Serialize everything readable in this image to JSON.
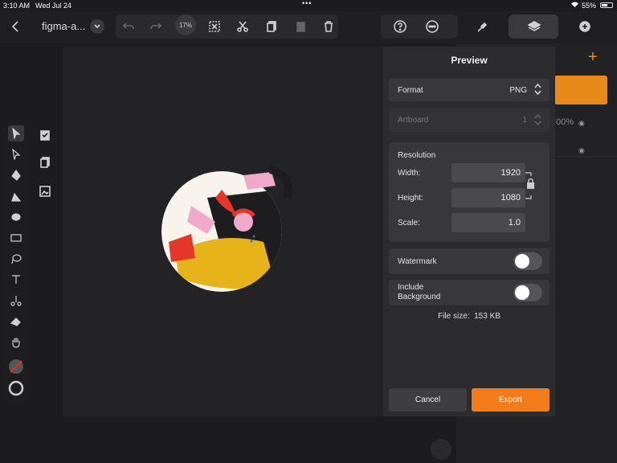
{
  "status_bar": {
    "time": "3:10 AM",
    "date": "Wed Jul 24",
    "battery": "55%",
    "battery_level": 0.55
  },
  "toolbar": {
    "document_title": "figma-a...",
    "zoom": "17%",
    "icons": [
      "back-icon",
      "chevron-down-icon",
      "undo-icon",
      "redo-icon",
      "zoom-indicator",
      "select-all-icon",
      "scissors-icon",
      "copy-icon",
      "paste-icon",
      "trash-icon",
      "help-icon",
      "more-icon",
      "brush-icon",
      "layers-icon",
      "add-icon"
    ]
  },
  "tools": [
    "select-arrow-icon",
    "direct-select-icon",
    "pen-icon",
    "pencil-icon",
    "brush-tool-icon",
    "rectangle-icon",
    "lasso-icon",
    "text-icon",
    "scissors-tool-icon",
    "eraser-icon",
    "hand-icon",
    "fill-none-icon",
    "stroke-icon"
  ],
  "secondary_tools": [
    "checkbox-icon",
    "document-copy-icon",
    "image-icon"
  ],
  "layers_panel": {
    "add_label": "+",
    "opacity_hint": "00%",
    "accent": "#e88a1a"
  },
  "export": {
    "title": "Preview",
    "format_label": "Format",
    "format_value": "PNG",
    "artboard_label": "Artboard",
    "artboard_value": "1",
    "resolution_label": "Resolution",
    "width_label": "Width:",
    "width_value": "1920",
    "height_label": "Height:",
    "height_value": "1080",
    "scale_label": "Scale:",
    "scale_value": "1.0",
    "watermark_label": "Watermark",
    "watermark_on": false,
    "include_bg_label_1": "Include",
    "include_bg_label_2": "Background",
    "include_bg_on": false,
    "file_size": "File size:  153 KB",
    "cancel_label": "Cancel",
    "export_label": "Export",
    "export_color": "#f47c1a"
  }
}
